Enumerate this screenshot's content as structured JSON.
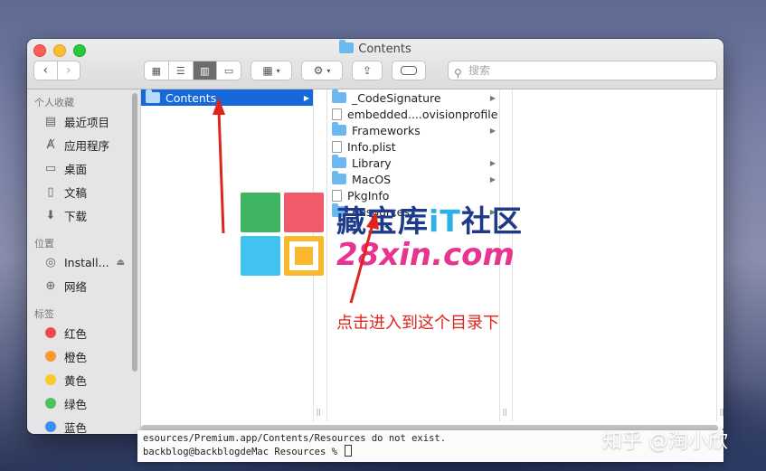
{
  "window": {
    "title": "Contents"
  },
  "toolbar": {
    "back_icon": "chevron-left-icon",
    "forward_icon": "chevron-right-icon",
    "view_modes": [
      "icon-view-icon",
      "list-view-icon",
      "column-view-icon",
      "gallery-view-icon"
    ],
    "active_view": "column",
    "search_placeholder": "搜索"
  },
  "sidebar": {
    "favorites_header": "个人收藏",
    "favorites": [
      {
        "label": "最近项目",
        "icon": "recents-icon"
      },
      {
        "label": "应用程序",
        "icon": "applications-icon"
      },
      {
        "label": "桌面",
        "icon": "desktop-icon"
      },
      {
        "label": "文稿",
        "icon": "documents-icon"
      },
      {
        "label": "下载",
        "icon": "downloads-icon"
      }
    ],
    "locations_header": "位置",
    "locations": [
      {
        "label": "Install...",
        "icon": "disk-icon"
      },
      {
        "label": "网络",
        "icon": "network-icon"
      }
    ],
    "tags_header": "标签",
    "tags": [
      {
        "label": "红色",
        "color": "#f04a4a"
      },
      {
        "label": "橙色",
        "color": "#f89a2c"
      },
      {
        "label": "黄色",
        "color": "#f8cc2c"
      },
      {
        "label": "绿色",
        "color": "#4cc35a"
      },
      {
        "label": "蓝色",
        "color": "#3c8ef0"
      }
    ]
  },
  "columns": {
    "col1": [
      {
        "name": "Contents",
        "type": "folder",
        "selected": true
      }
    ],
    "col2": [
      {
        "name": "_CodeSignature",
        "type": "folder"
      },
      {
        "name": "embedded....ovisionprofile",
        "type": "file"
      },
      {
        "name": "Frameworks",
        "type": "folder"
      },
      {
        "name": "Info.plist",
        "type": "file"
      },
      {
        "name": "Library",
        "type": "folder"
      },
      {
        "name": "MacOS",
        "type": "folder"
      },
      {
        "name": "PkgInfo",
        "type": "file"
      },
      {
        "name": "Resources",
        "type": "folder"
      }
    ]
  },
  "terminal": {
    "line1": "esources/Premium.app/Contents/Resources do not exist.",
    "line2": "backblog@backblogdeMac Resources % "
  },
  "watermark": {
    "line1_a": "藏宝库",
    "line1_b": "iT",
    "line1_c": "社区",
    "line2": "28xin.com",
    "logo_colors": [
      "#3fb563",
      "#f05a6b",
      "#42c2ee",
      "#f8b92c"
    ]
  },
  "annotation": {
    "text": "点击进入到这个目录下",
    "color": "#e0231c"
  },
  "credit": "知乎 @淘小欣"
}
